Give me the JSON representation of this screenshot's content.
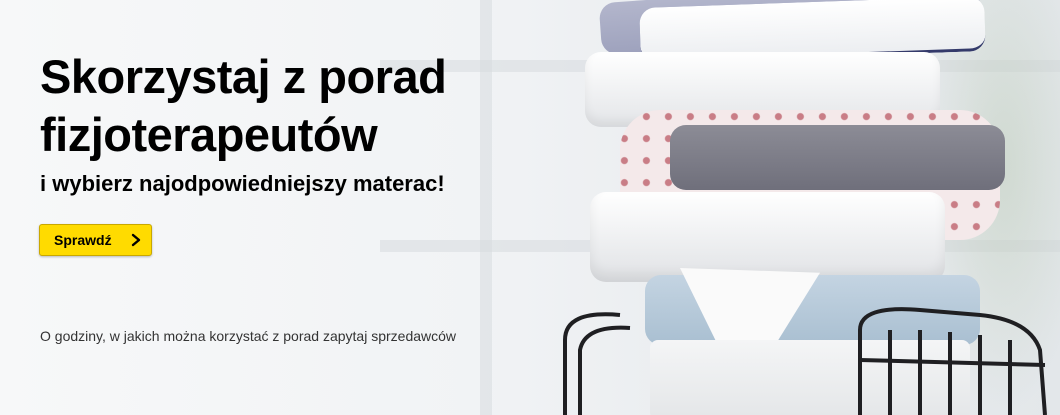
{
  "banner": {
    "headline_line1": "Skorzystaj z porad",
    "headline_line2": "fizjoterapeutów",
    "subheadline": "i wybierz najodpowiedniejszy materac!",
    "cta_label": "Sprawdź",
    "cta_icon": "chevron-right-icon",
    "note": "O godziny, w jakich można korzystać z porad zapytaj sprzedawców",
    "colors": {
      "cta_background": "#ffdb00",
      "text": "#000000",
      "note_text": "#333333"
    }
  }
}
